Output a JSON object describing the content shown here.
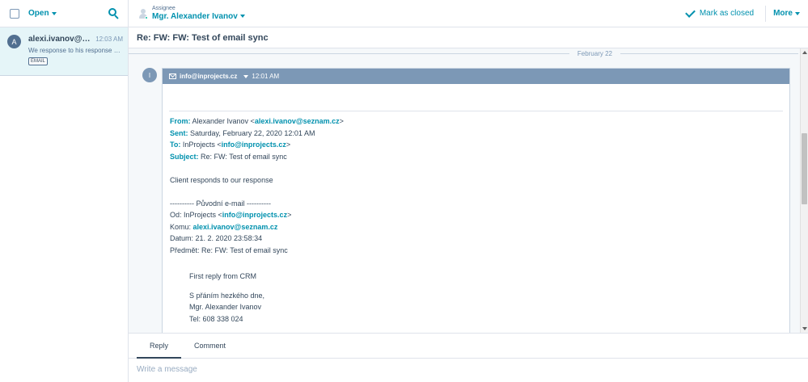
{
  "sidebar": {
    "status_label": "Open",
    "thread": {
      "avatar_initial": "A",
      "from": "alexi.ivanov@sezn...",
      "time": "12:03 AM",
      "preview": "We response to his response and ...",
      "tag": "EMAIL"
    }
  },
  "header": {
    "assignee_label": "Assignee",
    "assignee_name": "Mgr. Alexander Ivanov",
    "mark_closed_label": "Mark as closed",
    "more_label": "More"
  },
  "conversation": {
    "subject": "Re: FW: FW: Test of email sync",
    "date_divider": "February 22",
    "message": {
      "avatar_initial": "I",
      "from_address": "info@inprojects.cz",
      "time": "12:01 AM",
      "body": {
        "from_label": "From:",
        "from_name": "Alexander Ivanov <",
        "from_email": "alexi.ivanov@seznam.cz",
        "from_end": ">",
        "sent_label": "Sent:",
        "sent_value": "Saturday, February 22, 2020 12:01 AM",
        "to_label": "To:",
        "to_name": "InProjects <",
        "to_email": "info@inprojects.cz",
        "to_end": ">",
        "subject_label": "Subject:",
        "subject_value": "Re: FW: Test of email sync",
        "client_text": "Client responds to our response",
        "original_header": "---------- Původní e-mail ----------",
        "od_label": "Od: InProjects <",
        "od_email": "info@inprojects.cz",
        "od_end": ">",
        "komu_label": "Komu: ",
        "komu_email": "alexi.ivanov@seznam.cz",
        "datum": "Datum: 21. 2. 2020 23:58:34",
        "predmet": "Předmět: Re: FW: Test of email sync",
        "reply_text": "First reply from CRM",
        "sign_1": "S přáním hezkého dne,",
        "sign_2": "Mgr. Alexander Ivanov",
        "sign_3": "Tel: 608 338 024"
      }
    }
  },
  "composer": {
    "tab_reply": "Reply",
    "tab_comment": "Comment",
    "placeholder": "Write a message"
  },
  "colors": {
    "accent": "#0091ae",
    "text": "#33475b",
    "card_header": "#7c98b6",
    "selected_thread": "#e5f5f8"
  }
}
